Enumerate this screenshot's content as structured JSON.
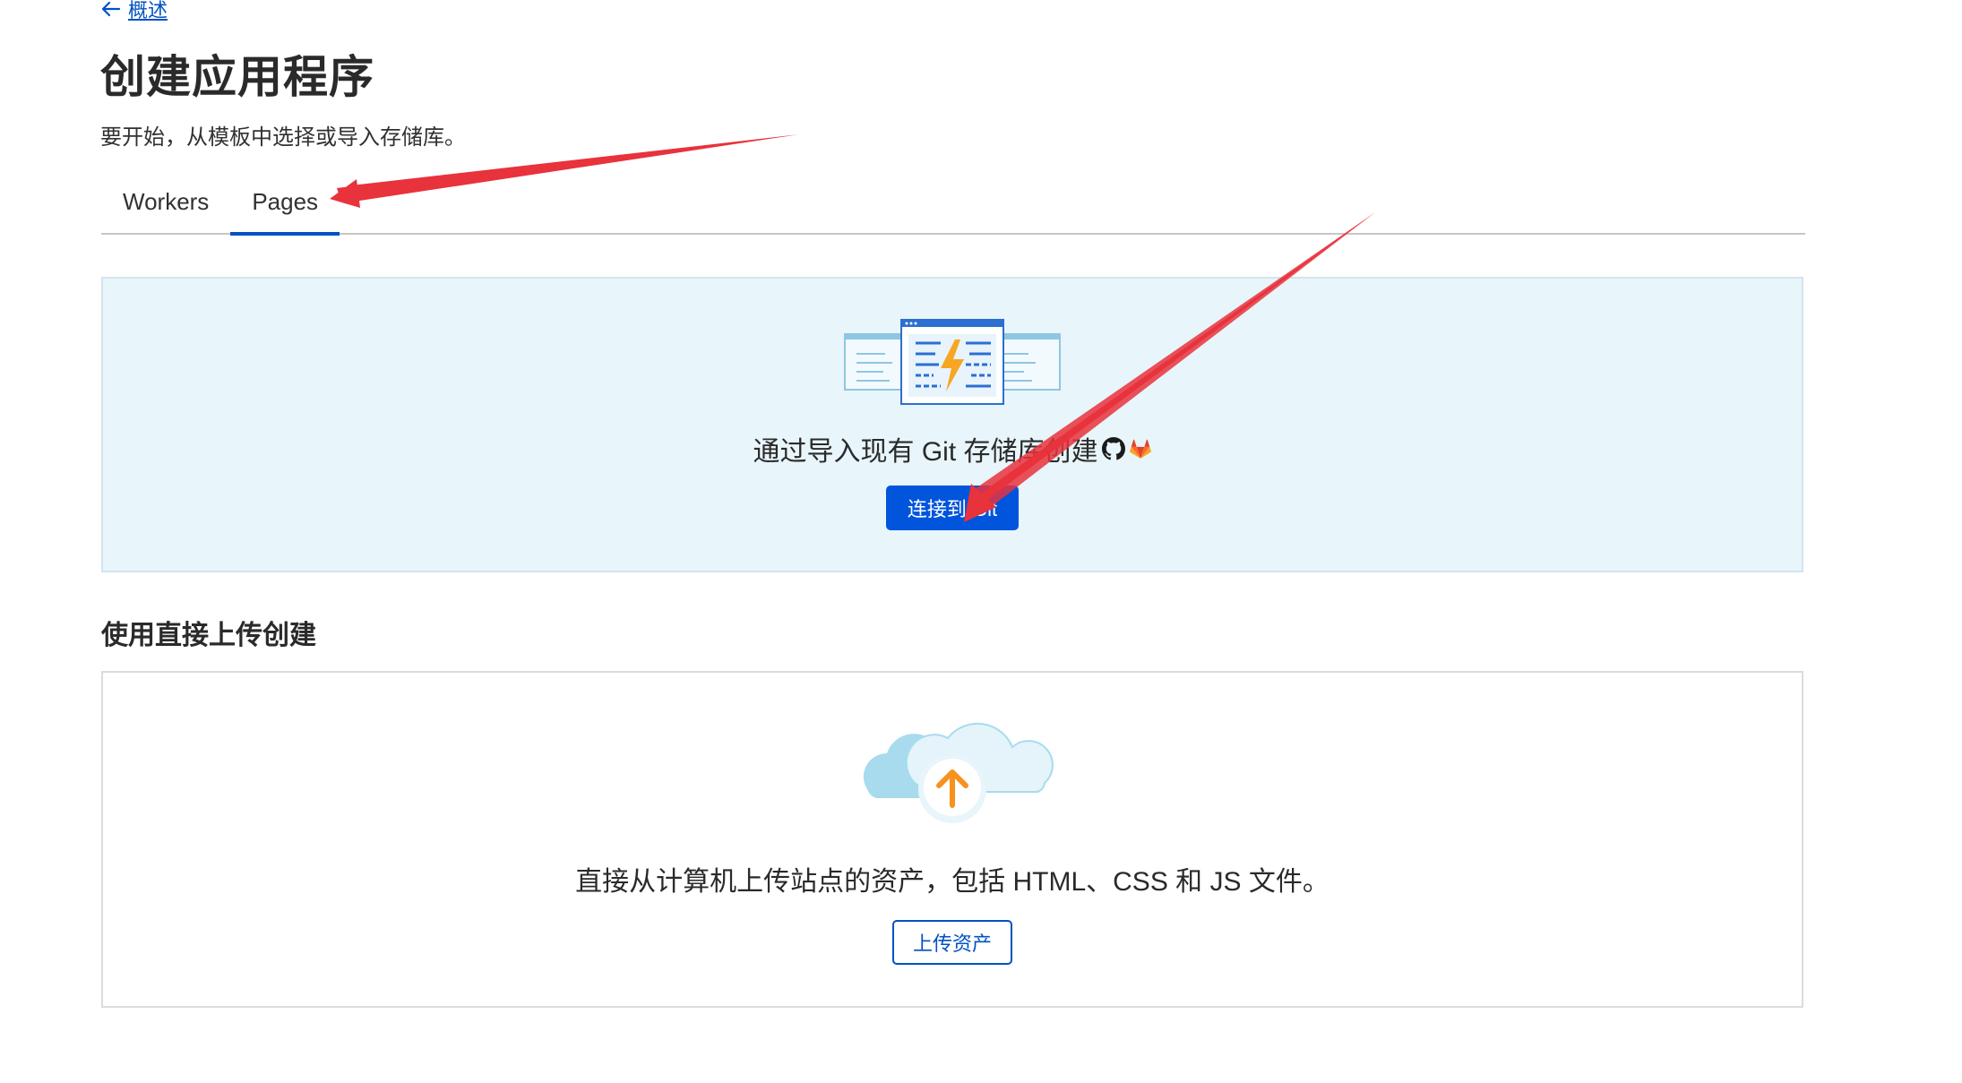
{
  "nav": {
    "back_label": "概述"
  },
  "header": {
    "title": "创建应用程序",
    "subtitle": "要开始，从模板中选择或导入存储库。"
  },
  "tabs": [
    {
      "label": "Workers",
      "active": false
    },
    {
      "label": "Pages",
      "active": true
    }
  ],
  "git_card": {
    "text": "通过导入现有 Git 存储库创建",
    "icons": [
      "github-icon",
      "gitlab-icon"
    ],
    "button_label": "连接到 Git"
  },
  "upload_section": {
    "heading": "使用直接上传创建",
    "text": "直接从计算机上传站点的资产，包括 HTML、CSS 和 JS 文件。",
    "button_label": "上传资产"
  },
  "colors": {
    "accent": "#0051c3",
    "primary_button": "#0055dc",
    "git_card_bg": "#e8f5fa",
    "annotation_arrow": "#e8323c"
  }
}
